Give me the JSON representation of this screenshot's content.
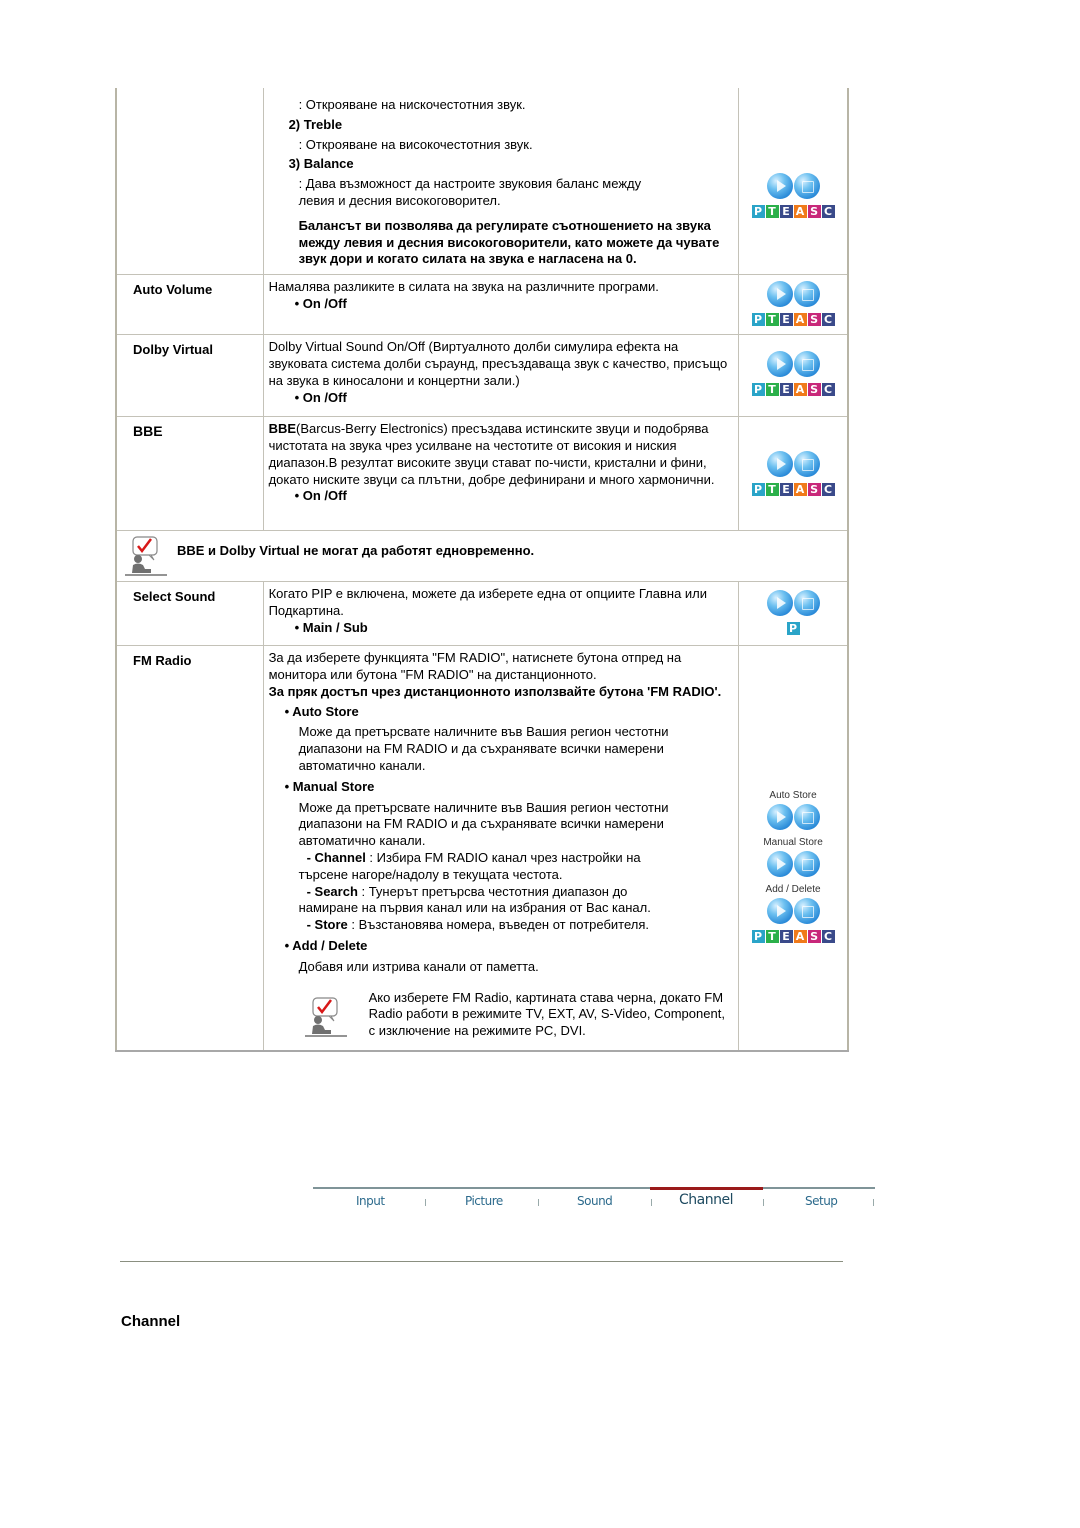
{
  "rows": {
    "balance": {
      "bass_desc": ": Открояване на нискочестотния звук.",
      "treble_head": "2) Treble",
      "treble_desc": ": Открояване на високочестотния звук.",
      "balance_head": "3) Balance",
      "balance_desc_1": ": Дава възможност да настроите звуковия баланс между",
      "balance_desc_2": "левия и десния високоговорител.",
      "balance_note": "Балансът ви позволява да регулирате съотношението на звука между левия и десния високоговорители, като можете да чувате звук дори и когато силата на звука е нагласена на 0."
    },
    "auto_volume": {
      "name": "Auto Volume",
      "desc": "Намалява разликите в силата на звука на различните програми.",
      "option": "• On /Off"
    },
    "dolby_virtual": {
      "name": "Dolby Virtual",
      "desc": "Dolby Virtual Sound On/Off (Виртуалното долби симулира ефекта на звуковата система долби съраунд, пресъздаваща звук с качество, присъщо на звука в киносалони и концертни зали.)",
      "option": "• On /Off"
    },
    "bbe": {
      "name": "BBE",
      "desc_bold": "BBE",
      "desc": "(Barcus-Berry Electronics) пресъздава истинските звуци и подобрява чистотата на звука чрез усилване на честотите от високия и ниския диапазон.В резултат високите звуци стават по-чисти, кристални и фини, докато ниските звуци са плътни, добре дефинирани и много хармонични.",
      "option": "• On /Off"
    },
    "note": {
      "text": "BBE и Dolby Virtual не могат да работят едновременно."
    },
    "select_sound": {
      "name": "Select Sound",
      "desc": "Когато PIP е включена, можете да изберете една от опциите Главна или Подкартина.",
      "option": "• Main / Sub"
    },
    "fm_radio": {
      "name": "FM Radio",
      "desc": "За да изберете функцията \"FM RADIO\", натиснете бутона отпред на монитора или бутона \"FM RADIO\" на дистанционното.",
      "desc_bold": "За пряк достъп чрез дистанционното използвайте бутона 'FM RADIO'.",
      "auto_store_head": "• Auto Store",
      "auto_store_desc": "Може да претърсвате наличните във Вашия регион честотни диапазони на FM RADIO и да съхранявате всички намерени автоматично канали.",
      "manual_store_head": "• Manual Store",
      "manual_store_desc": "Може да претърсвате наличните във Вашия регион честотни диапазони на FM RADIO и да съхранявате всички намерени автоматично канали.",
      "channel_label": "- Channel",
      "channel_desc": " : Избира FM RADIO канал чрез настройки на",
      "channel_desc_2": "търсене нагоре/надолу в текущата честота.",
      "search_label": "- Search",
      "search_desc": " : Тунерът претърсва честотния диапазон до",
      "search_desc_2": "намиране на първия канал или на избрания от Вас канал.",
      "store_label": "- Store",
      "store_desc": " : Възстановява номера, въведен от потребителя.",
      "add_delete_head": "• Add / Delete",
      "add_delete_desc": "Добавя или изтрива канали от паметта.",
      "inner_note": "Ако изберете FM Radio, картината става черна, докато FM Radio работи в режимите TV, EXT, AV, S-Video, Component, с изключение на режимите PC, DVI.",
      "icon_labels": [
        "Auto Store",
        "Manual Store",
        "Add / Delete"
      ]
    }
  },
  "badges": {
    "letters": [
      "P",
      "T",
      "E",
      "A",
      "S",
      "C"
    ],
    "colors": [
      "#2aa4c8",
      "#2bb04a",
      "#3a4a8a",
      "#f07a1a",
      "#c8287a",
      "#3a4a8a"
    ]
  },
  "tabs": [
    {
      "label": "Input",
      "active": false
    },
    {
      "label": "Picture",
      "active": false
    },
    {
      "label": "Sound",
      "active": false
    },
    {
      "label": "Channel",
      "active": true
    },
    {
      "label": "Setup",
      "active": false
    }
  ],
  "section_title": "Channel"
}
